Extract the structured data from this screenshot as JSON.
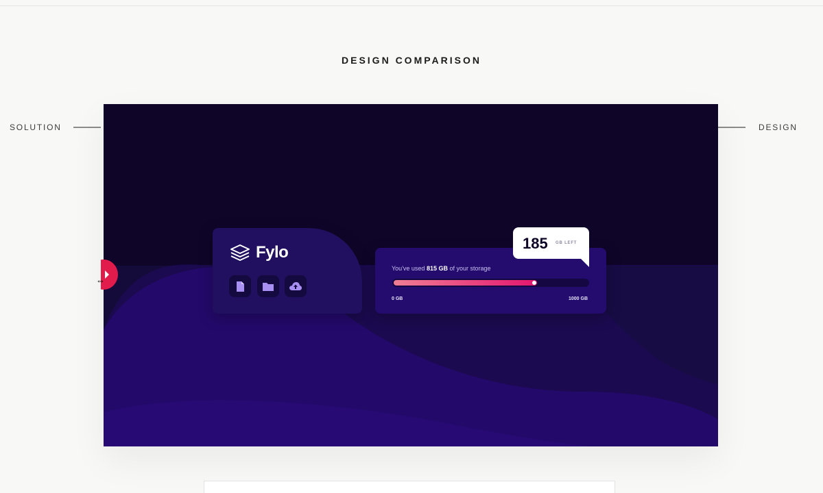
{
  "heading": "DESIGN COMPARISON",
  "labels": {
    "left": "SOLUTION",
    "right": "DESIGN"
  },
  "preview": {
    "logo_text": "Fylo",
    "icons": [
      "document-icon",
      "folder-icon",
      "upload-icon"
    ],
    "usage": {
      "prefix": "You've used ",
      "used": "815 GB",
      "suffix": " of your storage",
      "fraction": 0.815,
      "min_label": "0 GB",
      "max_label": "1000 GB"
    },
    "callout": {
      "number": "185",
      "unit": "GB LEFT"
    },
    "colors": {
      "background": "#0d0425",
      "card": "#20105f",
      "gradient_start": "#f07e95",
      "gradient_end": "#e2166f"
    }
  },
  "slider_handle_color": "#e11b4c"
}
